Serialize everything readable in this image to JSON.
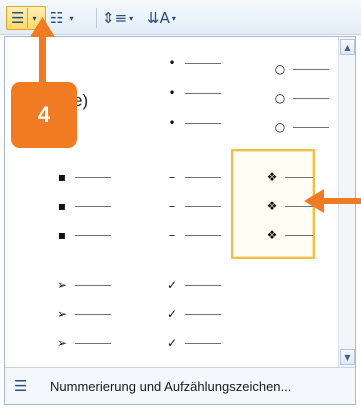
{
  "toolbar": {
    "bullets_icon": "bullet-list-icon",
    "numbering_icon": "numbered-list-icon",
    "line_spacing_icon": "line-spacing-icon",
    "sort_icon": "sort-icon",
    "dropdown_glyph": "▾",
    "glyphs": {
      "bullets": "☰",
      "numbering": "☷",
      "spacing": "⇕≡",
      "sort": "⇊A"
    }
  },
  "gallery": {
    "none_label": "e)",
    "bullet_rows": [
      {
        "glyph": "•"
      },
      {
        "glyph": "○"
      },
      {
        "glyph": "▪"
      },
      {
        "glyph": "–"
      },
      {
        "glyph": "❖"
      },
      {
        "glyph": "➢"
      },
      {
        "glyph": "✓"
      }
    ]
  },
  "scrollbar": {
    "up_glyph": "▲",
    "down_glyph": "▼"
  },
  "footer": {
    "icon": "bullet-list-icon",
    "label": "Nummerierung und Aufzählungszeichen..."
  },
  "annotation": {
    "step_number": "4",
    "color": "#f07b22"
  },
  "colors": {
    "selected_border": "#eabf4c",
    "toolbar_active": "#ffd766"
  }
}
